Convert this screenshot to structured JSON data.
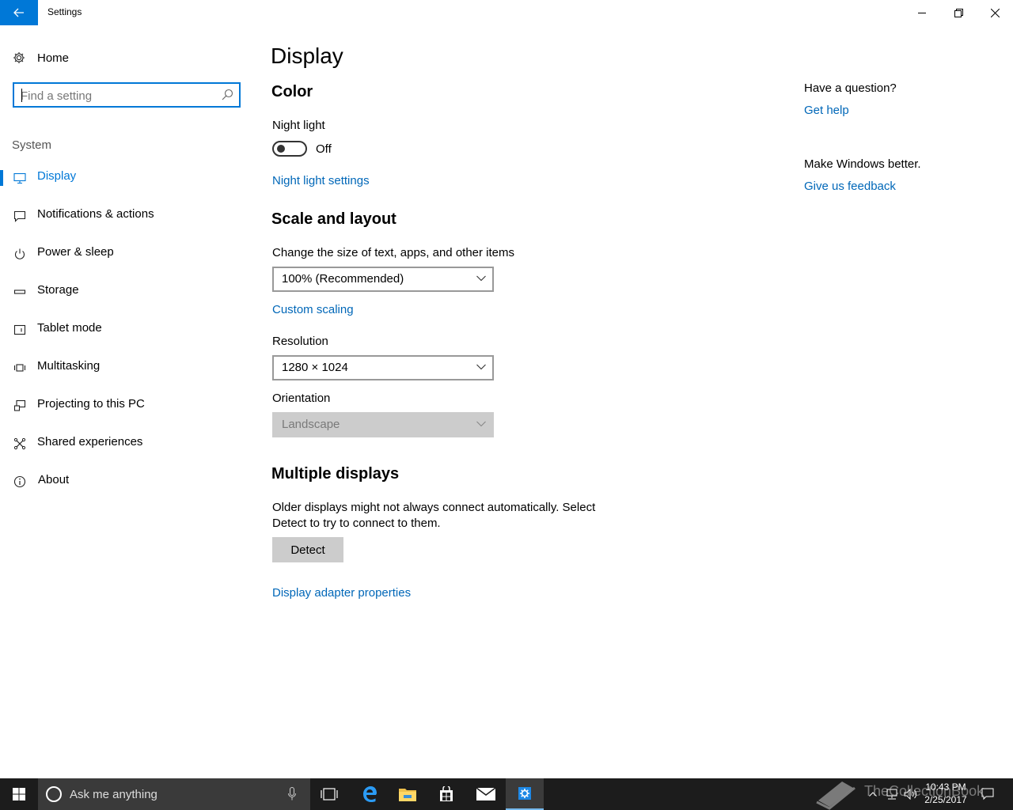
{
  "window": {
    "title": "Settings"
  },
  "sidebar": {
    "home_label": "Home",
    "search_placeholder": "Find a setting",
    "section_label": "System",
    "items": [
      {
        "label": "Display",
        "icon": "monitor-icon",
        "active": true
      },
      {
        "label": "Notifications & actions",
        "icon": "message-icon"
      },
      {
        "label": "Power & sleep",
        "icon": "power-icon"
      },
      {
        "label": "Storage",
        "icon": "storage-icon"
      },
      {
        "label": "Tablet mode",
        "icon": "tablet-icon"
      },
      {
        "label": "Multitasking",
        "icon": "multitasking-icon"
      },
      {
        "label": "Projecting to this PC",
        "icon": "projecting-icon"
      },
      {
        "label": "Shared experiences",
        "icon": "shared-icon"
      },
      {
        "label": "About",
        "icon": "info-icon"
      }
    ]
  },
  "main": {
    "title": "Display",
    "color": {
      "heading": "Color",
      "night_light_label": "Night light",
      "night_light_state": "Off",
      "night_light_settings_link": "Night light settings"
    },
    "scale": {
      "heading": "Scale and layout",
      "size_label": "Change the size of text, apps, and other items",
      "size_value": "100% (Recommended)",
      "custom_scaling_link": "Custom scaling",
      "resolution_label": "Resolution",
      "resolution_value": "1280 × 1024",
      "orientation_label": "Orientation",
      "orientation_value": "Landscape"
    },
    "multiple": {
      "heading": "Multiple displays",
      "description_line1": "Older displays might not always connect automatically. Select",
      "description_line2": "Detect to try to connect to them.",
      "detect_button": "Detect",
      "adapter_link": "Display adapter properties"
    }
  },
  "help": {
    "question": "Have a question?",
    "get_help": "Get help",
    "feedback_prompt": "Make Windows better.",
    "feedback_link": "Give us feedback"
  },
  "taskbar": {
    "search_placeholder": "Ask me anything",
    "time": "10:43 PM",
    "date": "2/25/2017",
    "watermark": "TheCollectionBook"
  },
  "colors": {
    "accent": "#0078d7",
    "link": "#0067b8",
    "taskbar": "#1c1c1c"
  }
}
